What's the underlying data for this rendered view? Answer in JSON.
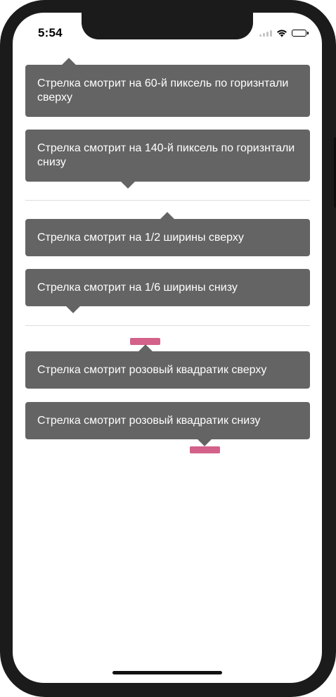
{
  "status_bar": {
    "time": "5:54",
    "icons": [
      "signal-icon",
      "wifi-icon",
      "battery-icon"
    ]
  },
  "tooltips": [
    {
      "text": "Стрелка смотрит на 60-й пиксель по горизнтали сверху",
      "arrow": "top"
    },
    {
      "text": "Стрелка смотрит на 140-й пиксель по горизнтали снизу",
      "arrow": "bottom"
    },
    {
      "text": "Стрелка смотрит на 1/2 ширины сверху",
      "arrow": "top"
    },
    {
      "text": "Стрелка смотрит на 1/6 ширины снизу",
      "arrow": "bottom"
    },
    {
      "text": "Стрелка смотрит розовый квадратик сверху",
      "arrow": "top"
    },
    {
      "text": "Стрелка смотрит розовый квадратик снизу",
      "arrow": "bottom"
    }
  ],
  "colors": {
    "bubble": "#646464",
    "pink_square": "#d3618a",
    "divider": "#dcdcdc",
    "device_frame": "#1b1b1b"
  }
}
